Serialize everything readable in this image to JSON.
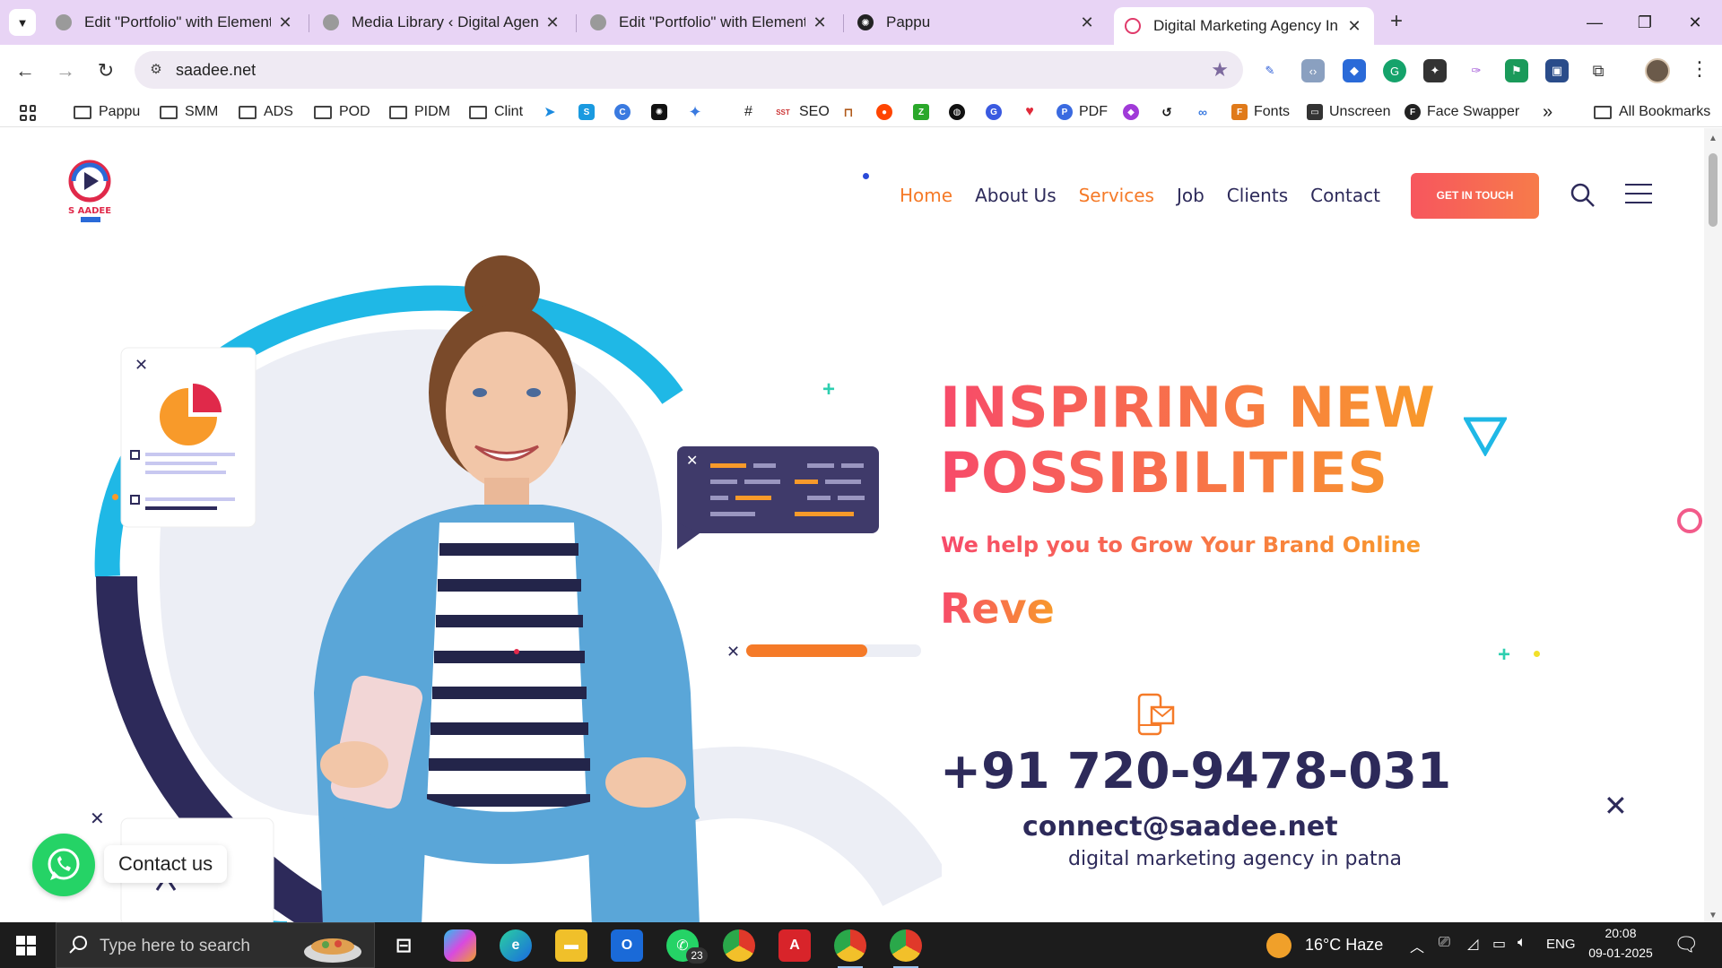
{
  "browser": {
    "tabs": [
      {
        "title": "Edit \"Portfolio\" with Elementor",
        "active": false
      },
      {
        "title": "Media Library ‹ Digital Agency –",
        "active": false
      },
      {
        "title": "Edit \"Portfolio\" with Elementor",
        "active": false
      },
      {
        "title": "Pappu",
        "active": false
      },
      {
        "title": "Digital Marketing Agency In Pat",
        "active": true
      }
    ],
    "url": "saadee.net",
    "bookmarks": {
      "folders": [
        "Pappu",
        "SMM",
        "ADS",
        "POD",
        "PIDM",
        "Clint"
      ],
      "items": [
        "#",
        "SEO",
        "PDF",
        "Fonts",
        "Unscreen",
        "Face Swapper"
      ],
      "all_bookmarks": "All Bookmarks",
      "overflow": "»"
    }
  },
  "site": {
    "logo_text": "S AADEE",
    "nav": [
      {
        "label": "Home",
        "active": true
      },
      {
        "label": "About Us",
        "active": false
      },
      {
        "label": "Services",
        "active": true
      },
      {
        "label": "Job",
        "active": false
      },
      {
        "label": "Clients",
        "active": false
      },
      {
        "label": "Contact",
        "active": false
      }
    ],
    "cta_label": "GET IN TOUCH",
    "hero": {
      "title_line1": "INSPIRING NEW",
      "title_line2": "POSSIBILITIES",
      "subtitle": "We help you to Grow Your Brand Online",
      "typed": "Reve",
      "phone": "+91 720-9478-031",
      "email": "connect@saadee.net",
      "tagline": "digital marketing agency in patna"
    },
    "whatsapp_label": "Contact us"
  },
  "taskbar": {
    "search_placeholder": "Type here to search",
    "whatsapp_badge": "23",
    "weather": "16°C  Haze",
    "language": "ENG",
    "time": "20:08",
    "date": "09-01-2025"
  },
  "colors": {
    "accent_orange": "#f57a28",
    "brand_navy": "#2d2a5a",
    "gradient_start": "#f74a6a",
    "gradient_end": "#f89a2a",
    "tab_strip": "#e8d4f5"
  }
}
